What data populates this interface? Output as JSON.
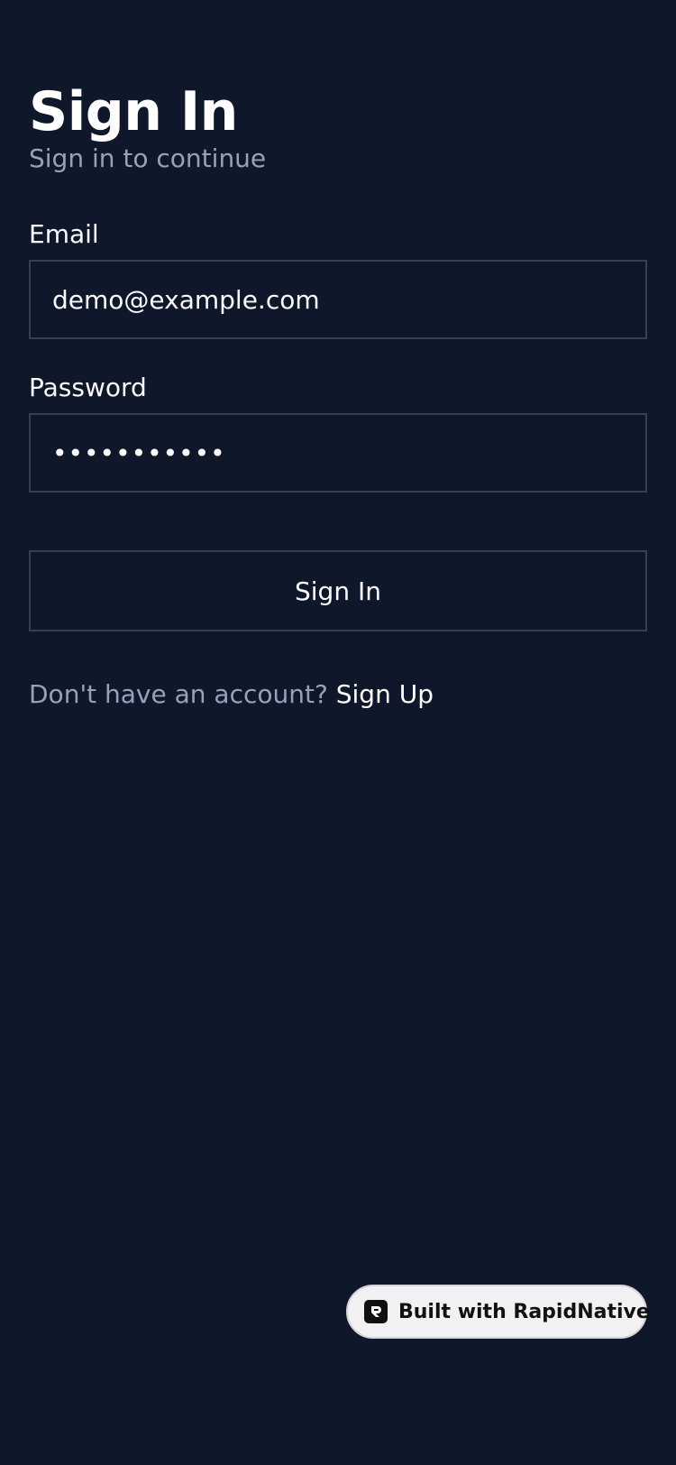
{
  "header": {
    "title": "Sign In",
    "subtitle": "Sign in to continue"
  },
  "form": {
    "email_label": "Email",
    "email_value": "demo@example.com",
    "password_label": "Password",
    "password_value": "•••••••••••",
    "submit_label": "Sign In"
  },
  "footer": {
    "prompt_text": "Don't have an account?",
    "signup_label": "Sign Up"
  },
  "badge": {
    "icon": "rapidnative-logo-icon",
    "label": "Built with RapidNative"
  },
  "colors": {
    "background": "#0f172a",
    "border": "#334155",
    "muted_text": "#94a3b8",
    "text": "#f8fafc"
  }
}
